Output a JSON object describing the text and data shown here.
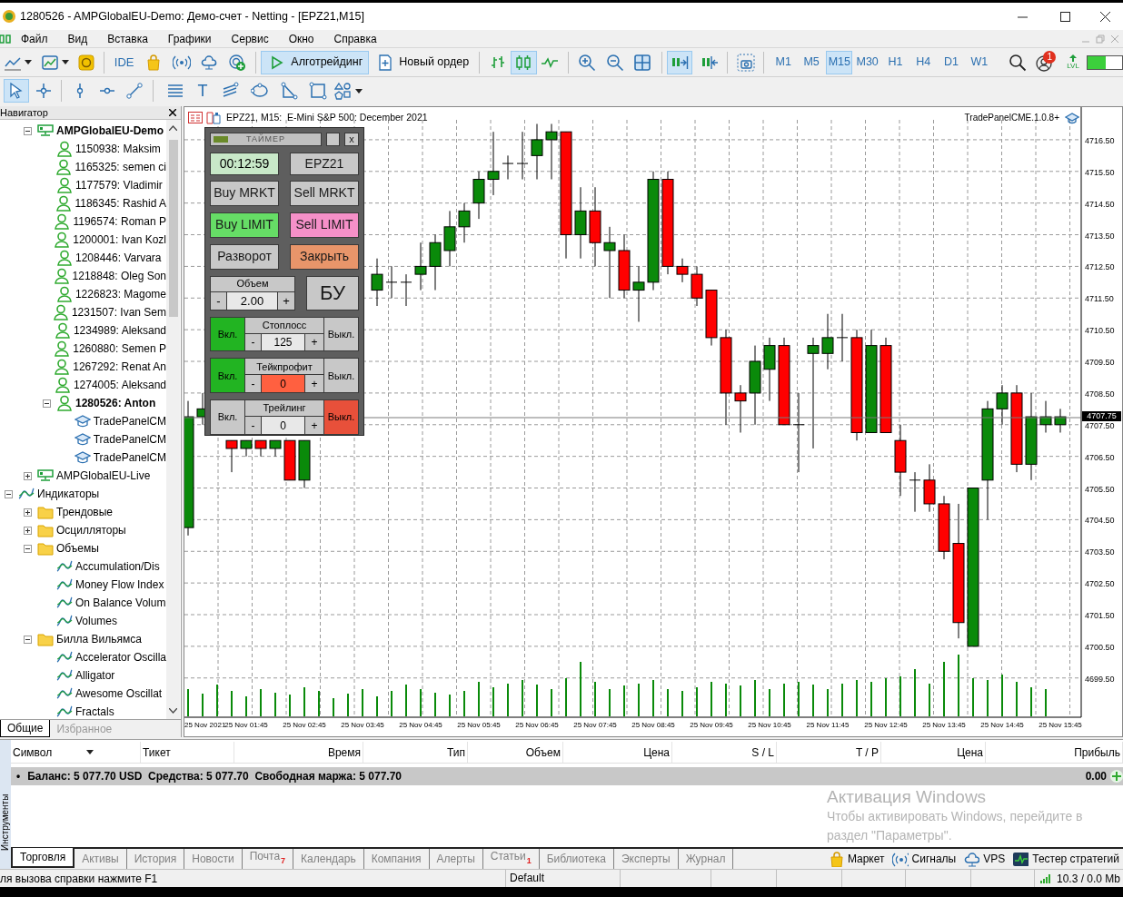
{
  "window": {
    "title": "1280526 - AMPGlobalEU-Demo: Демо-счет - Netting - [EPZ21,M15]"
  },
  "menu": [
    "Файл",
    "Вид",
    "Вставка",
    "Графики",
    "Сервис",
    "Окно",
    "Справка"
  ],
  "toolbar": {
    "ide": "IDE",
    "algo_trading": {
      "label": "Алготрейдинг",
      "selected": true
    },
    "new_order": "Новый ордер",
    "chart_types": [
      {
        "kind": "bars",
        "selected": false
      },
      {
        "kind": "candles",
        "selected": true
      },
      {
        "kind": "line",
        "selected": false
      }
    ],
    "auto_scroll": true,
    "chart_shift": false,
    "timeframes": [
      {
        "label": "M1",
        "selected": false
      },
      {
        "label": "M5",
        "selected": false
      },
      {
        "label": "M15",
        "selected": true
      },
      {
        "label": "M30",
        "selected": false
      },
      {
        "label": "H1",
        "selected": false
      },
      {
        "label": "H4",
        "selected": false
      },
      {
        "label": "D1",
        "selected": false
      },
      {
        "label": "W1",
        "selected": false
      }
    ],
    "notifications": "1",
    "level_badge": "LVL"
  },
  "drawing_tools": {
    "pointers": [
      {
        "kind": "cursor",
        "selected": true
      },
      {
        "kind": "crosshair",
        "selected": false
      }
    ],
    "text_tool": "T"
  },
  "navigator": {
    "title": "Навигатор",
    "accounts": [
      {
        "kind": "server",
        "label": "AMPGlobalEU-Demo",
        "bold": true,
        "expanded": true,
        "children": [
          {
            "kind": "account",
            "label": "1150938: Maksim",
            "bold": false
          },
          {
            "kind": "account",
            "label": "1165325: semen ci",
            "bold": false
          },
          {
            "kind": "account",
            "label": "1177579: Vladimir",
            "bold": false
          },
          {
            "kind": "account",
            "label": "1186345: Rashid A",
            "bold": false
          },
          {
            "kind": "account",
            "label": "1196574: Roman P",
            "bold": false
          },
          {
            "kind": "account",
            "label": "1200001: Ivan Kozl",
            "bold": false
          },
          {
            "kind": "account",
            "label": "1208446: Varvara",
            "bold": false
          },
          {
            "kind": "account",
            "label": "1218848: Oleg Son",
            "bold": false
          },
          {
            "kind": "account",
            "label": "1226823: Magome",
            "bold": false
          },
          {
            "kind": "account",
            "label": "1231507: Ivan Sem",
            "bold": false
          },
          {
            "kind": "account",
            "label": "1234989: Aleksand",
            "bold": false
          },
          {
            "kind": "account",
            "label": "1260880: Semen P",
            "bold": false
          },
          {
            "kind": "account",
            "label": "1267292: Renat An",
            "bold": false
          },
          {
            "kind": "account",
            "label": "1274005: Aleksand",
            "bold": false
          },
          {
            "kind": "account",
            "label": "1280526: Anton",
            "bold": true,
            "expanded": true,
            "children": [
              {
                "kind": "expert",
                "label": "TradePanelCM"
              },
              {
                "kind": "expert",
                "label": "TradePanelCM"
              },
              {
                "kind": "expert",
                "label": "TradePanelCM"
              }
            ]
          }
        ]
      },
      {
        "kind": "server",
        "label": "AMPGlobalEU-Live",
        "bold": false,
        "expanded": false
      }
    ],
    "tree": [
      {
        "kind": "indicators",
        "label": "Индикаторы",
        "expanded": true,
        "children": [
          {
            "kind": "folder",
            "label": "Трендовые",
            "expanded": false
          },
          {
            "kind": "folder",
            "label": "Осцилляторы",
            "expanded": false
          },
          {
            "kind": "folder",
            "label": "Объемы",
            "expanded": true,
            "children": [
              {
                "kind": "indicator",
                "label": "Accumulation/Dis"
              },
              {
                "kind": "indicator",
                "label": "Money Flow Index"
              },
              {
                "kind": "indicator",
                "label": "On Balance Volum"
              },
              {
                "kind": "indicator",
                "label": "Volumes"
              }
            ]
          },
          {
            "kind": "folder",
            "label": "Билла Вильямса",
            "expanded": true,
            "children": [
              {
                "kind": "indicator",
                "label": "Accelerator Oscilla"
              },
              {
                "kind": "indicator",
                "label": "Alligator"
              },
              {
                "kind": "indicator",
                "label": "Awesome Oscillat"
              },
              {
                "kind": "indicator",
                "label": "Fractals"
              }
            ]
          }
        ]
      }
    ],
    "tabs": [
      {
        "label": "Общие",
        "selected": true
      },
      {
        "label": "Избранное",
        "selected": false
      }
    ]
  },
  "chart": {
    "header": "EPZ21, M15:  E-Mini S&P 500: December 2021",
    "expert": "TradePanelCME.1.0.8+",
    "current_price": "4707.75",
    "date_label": "25 Nov 2021",
    "chart_data": {
      "type": "candlestick",
      "categories": [
        null,
        null,
        null,
        null,
        "25 Nov 01:45",
        null,
        null,
        null,
        "25 Nov 02:45",
        null,
        null,
        null,
        "25 Nov 03:45",
        null,
        null,
        null,
        "25 Nov 04:45",
        null,
        null,
        null,
        "25 Nov 05:45",
        null,
        null,
        null,
        "25 Nov 06:45",
        null,
        null,
        null,
        "25 Nov 07:45",
        null,
        null,
        null,
        "25 Nov 08:45",
        null,
        null,
        null,
        "25 Nov 09:45",
        null,
        null,
        null,
        "25 Nov 10:45",
        null,
        null,
        null,
        "25 Nov 11:45",
        null,
        null,
        null,
        "25 Nov 12:45",
        null,
        null,
        null,
        "25 Nov 13:45",
        null,
        null,
        null,
        "25 Nov 14:45",
        null,
        null,
        null,
        "25 Nov 15:45"
      ],
      "ohlc": [
        [
          4704.25,
          4708.25,
          4704.0,
          4707.75
        ],
        [
          4707.75,
          4708.5,
          4707.5,
          4708.0
        ],
        null,
        [
          4707.0,
          4707.0,
          4706.0,
          4706.75
        ],
        [
          4706.75,
          4707.0,
          4706.5,
          4707.0
        ],
        [
          4707.0,
          4707.0,
          4706.5,
          4706.75
        ],
        [
          4706.75,
          4707.0,
          4706.5,
          4707.0
        ],
        [
          4707.0,
          4707.0,
          4705.75,
          4705.75
        ],
        [
          4705.75,
          4707.0,
          4705.5,
          4707.0
        ],
        null,
        null,
        null,
        null,
        [
          4711.75,
          4712.75,
          4711.25,
          4712.25
        ],
        [
          4712.0,
          4712.5,
          4711.5,
          4712.0
        ],
        [
          4712.0,
          4712.25,
          4711.25,
          4712.0
        ],
        [
          4712.25,
          4713.25,
          4711.75,
          4712.5
        ],
        [
          4712.5,
          4713.5,
          4711.75,
          4713.25
        ],
        [
          4713.0,
          4714.25,
          4712.5,
          4713.75
        ],
        [
          4713.75,
          4714.5,
          4713.25,
          4714.25
        ],
        [
          4714.5,
          4715.5,
          4714.0,
          4715.25
        ],
        [
          4715.25,
          4716.75,
          4714.75,
          4715.5
        ],
        [
          4715.75,
          4716.0,
          4715.25,
          4715.75
        ],
        [
          4715.75,
          4716.75,
          4715.25,
          4715.75
        ],
        [
          4716.0,
          4717.0,
          4715.25,
          4716.5
        ],
        [
          4716.5,
          4717.0,
          4715.25,
          4716.75
        ],
        [
          4716.75,
          4716.75,
          4712.75,
          4713.5
        ],
        [
          4713.5,
          4715.0,
          4712.75,
          4714.25
        ],
        [
          4714.25,
          4715.0,
          4712.5,
          4713.25
        ],
        [
          4713.0,
          4713.75,
          4711.5,
          4713.25
        ],
        [
          4713.0,
          4713.5,
          4711.5,
          4711.75
        ],
        [
          4711.75,
          4712.5,
          4710.75,
          4712.0
        ],
        [
          4712.0,
          4715.5,
          4711.75,
          4715.25
        ],
        [
          4715.25,
          4715.5,
          4712.25,
          4712.5
        ],
        [
          4712.5,
          4712.75,
          4712.0,
          4712.25
        ],
        [
          4712.25,
          4712.5,
          4711.25,
          4711.5
        ],
        [
          4711.75,
          4711.75,
          4710.0,
          4710.25
        ],
        [
          4710.25,
          4710.5,
          4707.5,
          4708.5
        ],
        [
          4708.5,
          4708.75,
          4707.25,
          4708.25
        ],
        [
          4708.5,
          4710.0,
          4707.5,
          4709.5
        ],
        [
          4709.25,
          4710.25,
          4708.25,
          4710.0
        ],
        [
          4710.0,
          4710.25,
          4707.5,
          4707.5
        ],
        [
          4707.5,
          4708.5,
          4706.0,
          4707.5
        ],
        [
          4709.75,
          4710.25,
          4706.75,
          4710.0
        ],
        [
          4709.75,
          4711.0,
          4709.25,
          4710.25
        ],
        [
          4710.25,
          4711.0,
          4709.5,
          4710.25
        ],
        [
          4710.25,
          4710.5,
          4707.0,
          4707.25
        ],
        [
          4707.25,
          4710.5,
          4707.25,
          4710.0
        ],
        [
          4710.0,
          4710.25,
          4707.25,
          4707.25
        ],
        [
          4707.0,
          4707.5,
          4705.25,
          4706.0
        ],
        [
          4705.75,
          4706.0,
          4704.75,
          4705.75
        ],
        [
          4705.75,
          4706.25,
          4704.75,
          4705.0
        ],
        [
          4705.0,
          4705.25,
          4703.25,
          4703.5
        ],
        [
          4703.75,
          4705.0,
          4700.75,
          4701.25
        ],
        [
          4700.5,
          4705.5,
          4700.5,
          4705.5
        ],
        [
          4705.75,
          4708.25,
          4704.5,
          4708.0
        ],
        [
          4708.0,
          4708.75,
          4707.5,
          4708.5
        ],
        [
          4708.5,
          4708.75,
          4706.0,
          4706.25
        ],
        [
          4706.25,
          4708.5,
          4705.75,
          4707.75
        ],
        [
          4707.5,
          4708.25,
          4707.25,
          4707.75
        ],
        [
          4707.5,
          4708.0,
          4707.25,
          4707.75
        ]
      ],
      "ylim": [
        4698.26,
        4717.53
      ],
      "yticks": [
        {
          "value": 4716.5,
          "label": "4716.50"
        },
        {
          "value": 4715.5,
          "label": "4715.50"
        },
        {
          "value": 4714.5,
          "label": "4714.50"
        },
        {
          "value": 4713.5,
          "label": "4713.50"
        },
        {
          "value": 4712.5,
          "label": "4712.50"
        },
        {
          "value": 4711.5,
          "label": "4711.50"
        },
        {
          "value": 4710.5,
          "label": "4710.50"
        },
        {
          "value": 4709.5,
          "label": "4709.50"
        },
        {
          "value": 4708.5,
          "label": "4708.50"
        },
        {
          "value": 4707.5,
          "label": "4707.50"
        },
        {
          "value": 4706.5,
          "label": "4706.50"
        },
        {
          "value": 4705.5,
          "label": "4705.50"
        },
        {
          "value": 4704.5,
          "label": "4704.50"
        },
        {
          "value": 4703.5,
          "label": "4703.50"
        },
        {
          "value": 4702.5,
          "label": "4702.50"
        },
        {
          "value": 4701.5,
          "label": "4701.50"
        },
        {
          "value": 4700.5,
          "label": "4700.50"
        },
        {
          "value": 4699.5,
          "label": "4699.50"
        }
      ],
      "grid": true
    }
  },
  "trade_panel": {
    "title": "ТАЙМЕР",
    "close": "x",
    "timer": "00:12:59",
    "symbol": "EPZ21",
    "buttons": [
      {
        "label": "Buy MRKT",
        "color": "#c8c8c8"
      },
      {
        "label": "Sell MRKT",
        "color": "#c8c8c8"
      },
      {
        "label": "Buy LIMIT",
        "color": "#66dd66"
      },
      {
        "label": "Sell LIMIT",
        "color": "#f590c8"
      },
      {
        "label": "Разворот",
        "color": "#c8c8c8"
      },
      {
        "label": "Закрыть",
        "color": "#e8956a"
      }
    ],
    "volume": {
      "label": "Объем",
      "minus": "-",
      "value": "2.00",
      "plus": "+"
    },
    "breakeven": "БУ",
    "controls": [
      {
        "label": "Стоплосс",
        "on": "Вкл.",
        "off": "Выкл.",
        "minus": "-",
        "value": "125",
        "plus": "+",
        "enabled": true,
        "value_alert": false
      },
      {
        "label": "Тейкпрофит",
        "on": "Вкл.",
        "off": "Выкл.",
        "minus": "-",
        "value": "0",
        "plus": "+",
        "enabled": true,
        "value_alert": true
      },
      {
        "label": "Трейлинг",
        "on": "Вкл.",
        "off": "Выкл.",
        "minus": "-",
        "value": "0",
        "plus": "+",
        "enabled": false,
        "value_alert": false
      }
    ]
  },
  "terminal": {
    "side_tab": "Инструменты",
    "columns": [
      "Символ",
      "Тикет",
      "Время",
      "Тип",
      "Объем",
      "Цена",
      "S / L",
      "T / P",
      "Цена",
      "Прибыль"
    ],
    "balance": {
      "bullet": "•",
      "text": "Баланс: 5 077.70 USD  Средства: 5 077.70  Свободная маржа: 5 077.70",
      "profit": "0.00"
    },
    "tabs": [
      {
        "label": "Торговля",
        "selected": true
      },
      {
        "label": "Активы",
        "selected": false
      },
      {
        "label": "История",
        "selected": false
      },
      {
        "label": "Новости",
        "selected": false
      },
      {
        "label": "Почта",
        "selected": false,
        "badge": "7"
      },
      {
        "label": "Календарь",
        "selected": false
      },
      {
        "label": "Компания",
        "selected": false
      },
      {
        "label": "Алерты",
        "selected": false
      },
      {
        "label": "Статьи",
        "selected": false,
        "badge": "1"
      },
      {
        "label": "Библиотека",
        "selected": false
      },
      {
        "label": "Эксперты",
        "selected": false
      },
      {
        "label": "Журнал",
        "selected": false
      }
    ],
    "services": [
      {
        "kind": "market",
        "label": "Маркет"
      },
      {
        "kind": "signals",
        "label": "Сигналы"
      },
      {
        "kind": "vps",
        "label": "VPS"
      },
      {
        "kind": "tester",
        "label": "Тестер стратегий"
      }
    ]
  },
  "activation_notice": {
    "title": "Активация Windows",
    "text": "Чтобы активировать Windows, перейдите в раздел \"Параметры\"."
  },
  "status_bar": {
    "hint": "ля вызова справки нажмите F1",
    "profile": "Default",
    "traffic": "10.3 / 0.0 Mb"
  }
}
